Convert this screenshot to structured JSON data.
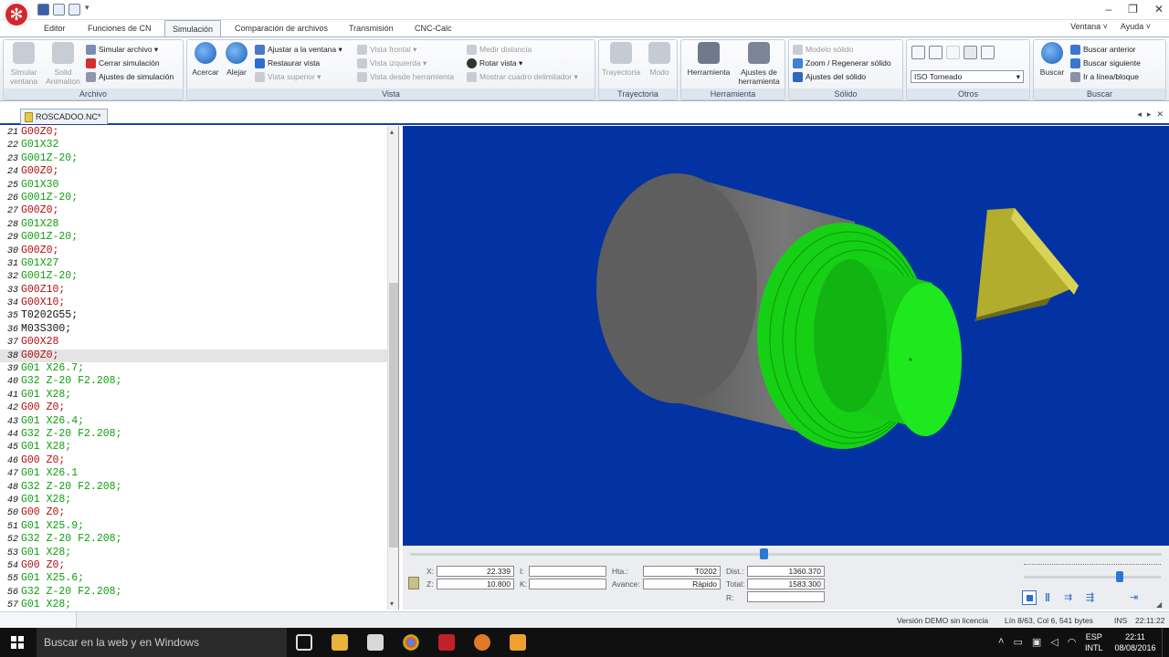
{
  "title_bar": {
    "window_controls": [
      "–",
      "❐",
      "✕"
    ]
  },
  "ribbon_tabs": [
    "Editor",
    "Funciones de CN",
    "Simulación",
    "Comparación de archivos",
    "Transmisión",
    "CNC-Calc"
  ],
  "active_tab": "Simulación",
  "help_menu": {
    "ventana": "Ventana ˅",
    "ayuda": "Ayuda ˅"
  },
  "ribbon": {
    "archivo": {
      "title": "Archivo",
      "simular_ventana": "Simular ventana",
      "solid_animation": "Solid Animation",
      "simular_archivo": "Simular archivo ▾",
      "cerrar_simulacion": "Cerrar simulación",
      "ajustes_simulacion": "Ajustes de simulación"
    },
    "vista": {
      "title": "Vista",
      "acercar": "Acercar",
      "alejar": "Alejar",
      "ajustar": "Ajustar a la ventana ▾",
      "restaurar": "Restaurar vista",
      "superior": "Vista superior ▾",
      "frontal": "Vista frontal ▾",
      "izquierda": "Vista izquierda ▾",
      "desde_herramienta": "Vista desde herramienta",
      "medir": "Medir distancia",
      "rotar": "Rotar vista ▾",
      "cuadro": "Mostrar cuadro delimitador ▾"
    },
    "trayectoria": {
      "title": "Trayectoria",
      "trayectoria": "Trayectoria",
      "modo": "Modo"
    },
    "herramienta": {
      "title": "Herramienta",
      "herramienta": "Herramienta",
      "ajustes": "Ajustes de herramienta"
    },
    "solido": {
      "title": "Sólido",
      "modelo": "Modelo sólido",
      "zoom": "Zoom / Regenerar sólido",
      "ajustes": "Ajustes del sólido"
    },
    "otros": {
      "title": "Otros",
      "combo_value": "ISO Torneado"
    },
    "buscar": {
      "title": "Buscar",
      "buscar": "Buscar",
      "anterior": "Buscar anterior",
      "siguiente": "Buscar siguiente",
      "ir": "Ir a línea/bloque"
    }
  },
  "document_tab": "ROSCADOO.NC*",
  "code_lines": [
    {
      "n": "21",
      "t": "G00Z0;",
      "c": "r"
    },
    {
      "n": "22",
      "t": "G01X32",
      "c": "g"
    },
    {
      "n": "23",
      "t": "G001Z-20;",
      "c": "g"
    },
    {
      "n": "24",
      "t": "G00Z0;",
      "c": "r"
    },
    {
      "n": "25",
      "t": "G01X30",
      "c": "g"
    },
    {
      "n": "26",
      "t": "G001Z-20;",
      "c": "g"
    },
    {
      "n": "27",
      "t": "G00Z0;",
      "c": "r"
    },
    {
      "n": "28",
      "t": "G01X28",
      "c": "g"
    },
    {
      "n": "29",
      "t": "G001Z-20;",
      "c": "g"
    },
    {
      "n": "30",
      "t": "G00Z0;",
      "c": "r"
    },
    {
      "n": "31",
      "t": "G01X27",
      "c": "g"
    },
    {
      "n": "32",
      "t": "G001Z-20;",
      "c": "g"
    },
    {
      "n": "33",
      "t": "G00Z10;",
      "c": "r"
    },
    {
      "n": "34",
      "t": "G00X10;",
      "c": "r"
    },
    {
      "n": "35",
      "t": "T0202G55;",
      "c": "k"
    },
    {
      "n": "36",
      "t": "M03S300;",
      "c": "k"
    },
    {
      "n": "37",
      "t": "G00X28",
      "c": "r"
    },
    {
      "n": "38",
      "t": "G00Z0;",
      "c": "r",
      "hl": true
    },
    {
      "n": "39",
      "t": "G01 X26.7;",
      "c": "g"
    },
    {
      "n": "40",
      "t": "G32 Z-20 F2.208;",
      "c": "g"
    },
    {
      "n": "41",
      "t": "G01 X28;",
      "c": "g"
    },
    {
      "n": "42",
      "t": "G00 Z0;",
      "c": "r"
    },
    {
      "n": "43",
      "t": "G01 X26.4;",
      "c": "g"
    },
    {
      "n": "44",
      "t": "G32 Z-20 F2.208;",
      "c": "g"
    },
    {
      "n": "45",
      "t": "G01 X28;",
      "c": "g"
    },
    {
      "n": "46",
      "t": "G00 Z0;",
      "c": "r"
    },
    {
      "n": "47",
      "t": "G01 X26.1",
      "c": "g"
    },
    {
      "n": "48",
      "t": "G32 Z-20 F2.208;",
      "c": "g"
    },
    {
      "n": "49",
      "t": "G01 X28;",
      "c": "g"
    },
    {
      "n": "50",
      "t": "G00 Z0;",
      "c": "r"
    },
    {
      "n": "51",
      "t": "G01 X25.9;",
      "c": "g"
    },
    {
      "n": "52",
      "t": "G32 Z-20 F2.208;",
      "c": "g"
    },
    {
      "n": "53",
      "t": "G01 X28;",
      "c": "g"
    },
    {
      "n": "54",
      "t": "G00 Z0;",
      "c": "r"
    },
    {
      "n": "55",
      "t": "G01 X25.6;",
      "c": "g"
    },
    {
      "n": "56",
      "t": "G32 Z-20 F2.208;",
      "c": "g"
    },
    {
      "n": "57",
      "t": "G01 X28;",
      "c": "g"
    }
  ],
  "sim_panel": {
    "x_label": "X:",
    "x_value": "22.339",
    "z_label": "Z:",
    "z_value": "10.800",
    "i_label": "I:",
    "i_value": "",
    "k_label": "K:",
    "k_value": "",
    "hta_label": "Hta.:",
    "hta_value": "T0202",
    "avance_label": "Avance:",
    "avance_value": "Rápido",
    "dist_label": "Dist.:",
    "dist_value": "1360.370",
    "total_label": "Total:",
    "total_value": "1583.300",
    "r_label": "R:",
    "r_value": "",
    "progress": 0.47,
    "speed": 0.7
  },
  "status_bar": {
    "license": "Versión DEMO sin licencia",
    "position": "Lín 8/63, Col 6, 541 bytes",
    "mode": "INS",
    "time": "22:11:22"
  },
  "taskbar": {
    "search": "Buscar en la web y en Windows",
    "lang_top": "ESP",
    "lang_bottom": "INTL",
    "clock_time": "22:11",
    "clock_date": "08/08/2016"
  },
  "colors": {
    "viewport": "#0333a3",
    "part_green": "#1ee81e",
    "stock_gray": "#6e6e6e",
    "tool_yellow": "#b3ad2e"
  }
}
